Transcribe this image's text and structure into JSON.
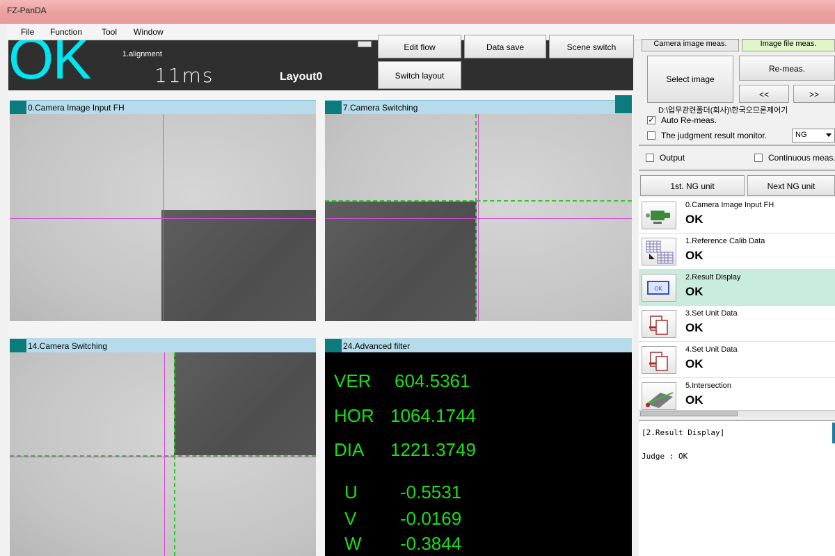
{
  "window": {
    "title": "FZ-PanDA"
  },
  "menu": [
    {
      "label": "File"
    },
    {
      "label": "Function"
    },
    {
      "label": "Tool"
    },
    {
      "label": "Window"
    }
  ],
  "status": {
    "judgement": "OK",
    "step_name": "1.alignment",
    "time": "11ms",
    "layout": "Layout0"
  },
  "toolbar": {
    "edit_flow": "Edit flow",
    "data_save": "Data save",
    "scene_switch": "Scene switch",
    "switch_layout": "Switch layout"
  },
  "panels": [
    {
      "label": "0.Camera Image Input FH"
    },
    {
      "label": "7.Camera Switching"
    },
    {
      "label": "14.Camera Switching"
    },
    {
      "label": "24.Advanced filter"
    }
  ],
  "measurements": [
    {
      "key": "VER",
      "value": "604.5361"
    },
    {
      "key": "HOR",
      "value": "1064.1744"
    },
    {
      "key": "DIA",
      "value": "1221.3749"
    },
    {
      "key": "U",
      "value": "-0.5531"
    },
    {
      "key": "V",
      "value": "-0.0169"
    },
    {
      "key": "W",
      "value": "-0.3844"
    }
  ],
  "right": {
    "tab_camera": "Camera image meas.",
    "tab_file": "Image file meas.",
    "select_image": "Select image",
    "remeas": "Re-meas.",
    "prev": "<<",
    "next": ">>",
    "path": "D:\\업무관련폴더(회사)\\한국오므론제어기",
    "auto_remeas": "Auto Re-meas.",
    "judgment_monitor": "The judgment result monitor.",
    "judgment_value": "NG",
    "output": "Output",
    "continuous": "Continuous meas.",
    "first_ng": "1st. NG unit",
    "next_ng": "Next NG unit"
  },
  "flow": [
    {
      "name": "0.Camera Image Input FH",
      "result": "OK"
    },
    {
      "name": "1.Reference Calib Data",
      "result": "OK"
    },
    {
      "name": "2.Result Display",
      "result": "OK"
    },
    {
      "name": "3.Set Unit Data",
      "result": "OK"
    },
    {
      "name": "4.Set Unit Data",
      "result": "OK"
    },
    {
      "name": "5.Intersection",
      "result": "OK"
    }
  ],
  "detail": {
    "header": "[2.Result Display]",
    "judge": "Judge : OK"
  },
  "colors": {
    "ok_cyan": "#00e5ef",
    "measure_green": "#16e016",
    "panel_header": "#b6dcec",
    "selected_row": "#c9ecdc"
  }
}
